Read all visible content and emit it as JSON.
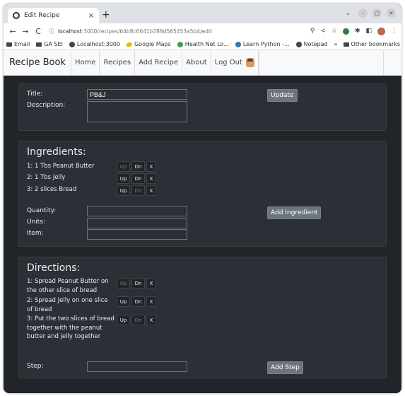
{
  "browser": {
    "tab_title": "Edit Recipe",
    "tab_close": "×",
    "new_tab": "+",
    "url_host": "localhost",
    "url_path": ":3000/recipes/64b8c6641b788d565453a5b4/edit",
    "bookmarks": [
      "Email",
      "GA SEI",
      "Localhost:3000",
      "Google Maps",
      "Health Net Lo...",
      "Learn Python -...",
      "Notepad"
    ],
    "bookmarks_more": "»",
    "other_bookmarks": "Other bookmarks"
  },
  "nav": {
    "brand": "Recipe Book",
    "links": [
      "Home",
      "Recipes",
      "Add Recipe",
      "About",
      "Log Out"
    ]
  },
  "recipe_form": {
    "title_label": "Title:",
    "title_value": "PB&J",
    "description_label": "Description:",
    "description_value": "",
    "update_button": "Update"
  },
  "ingredients": {
    "heading": "Ingredients:",
    "items": [
      "1: 1 Tbs Peanut Butter",
      "2: 1 Tbs Jelly",
      "3: 2 slices Bread"
    ],
    "quantity_label": "Quantity:",
    "units_label": "Units:",
    "item_label": "Item:",
    "add_button": "Add Ingredient"
  },
  "directions": {
    "heading": "Directions:",
    "steps": [
      "1: Spread Peanut Butter on the other slice of bread",
      "2: Spread Jelly on one slice of bread",
      "3: Put the two slices of bread together with the peanut butter and jelly together"
    ],
    "step_label": "Step:",
    "add_button": "Add Step"
  },
  "controls": {
    "up": "Up",
    "down": "Dn",
    "remove": "X"
  }
}
